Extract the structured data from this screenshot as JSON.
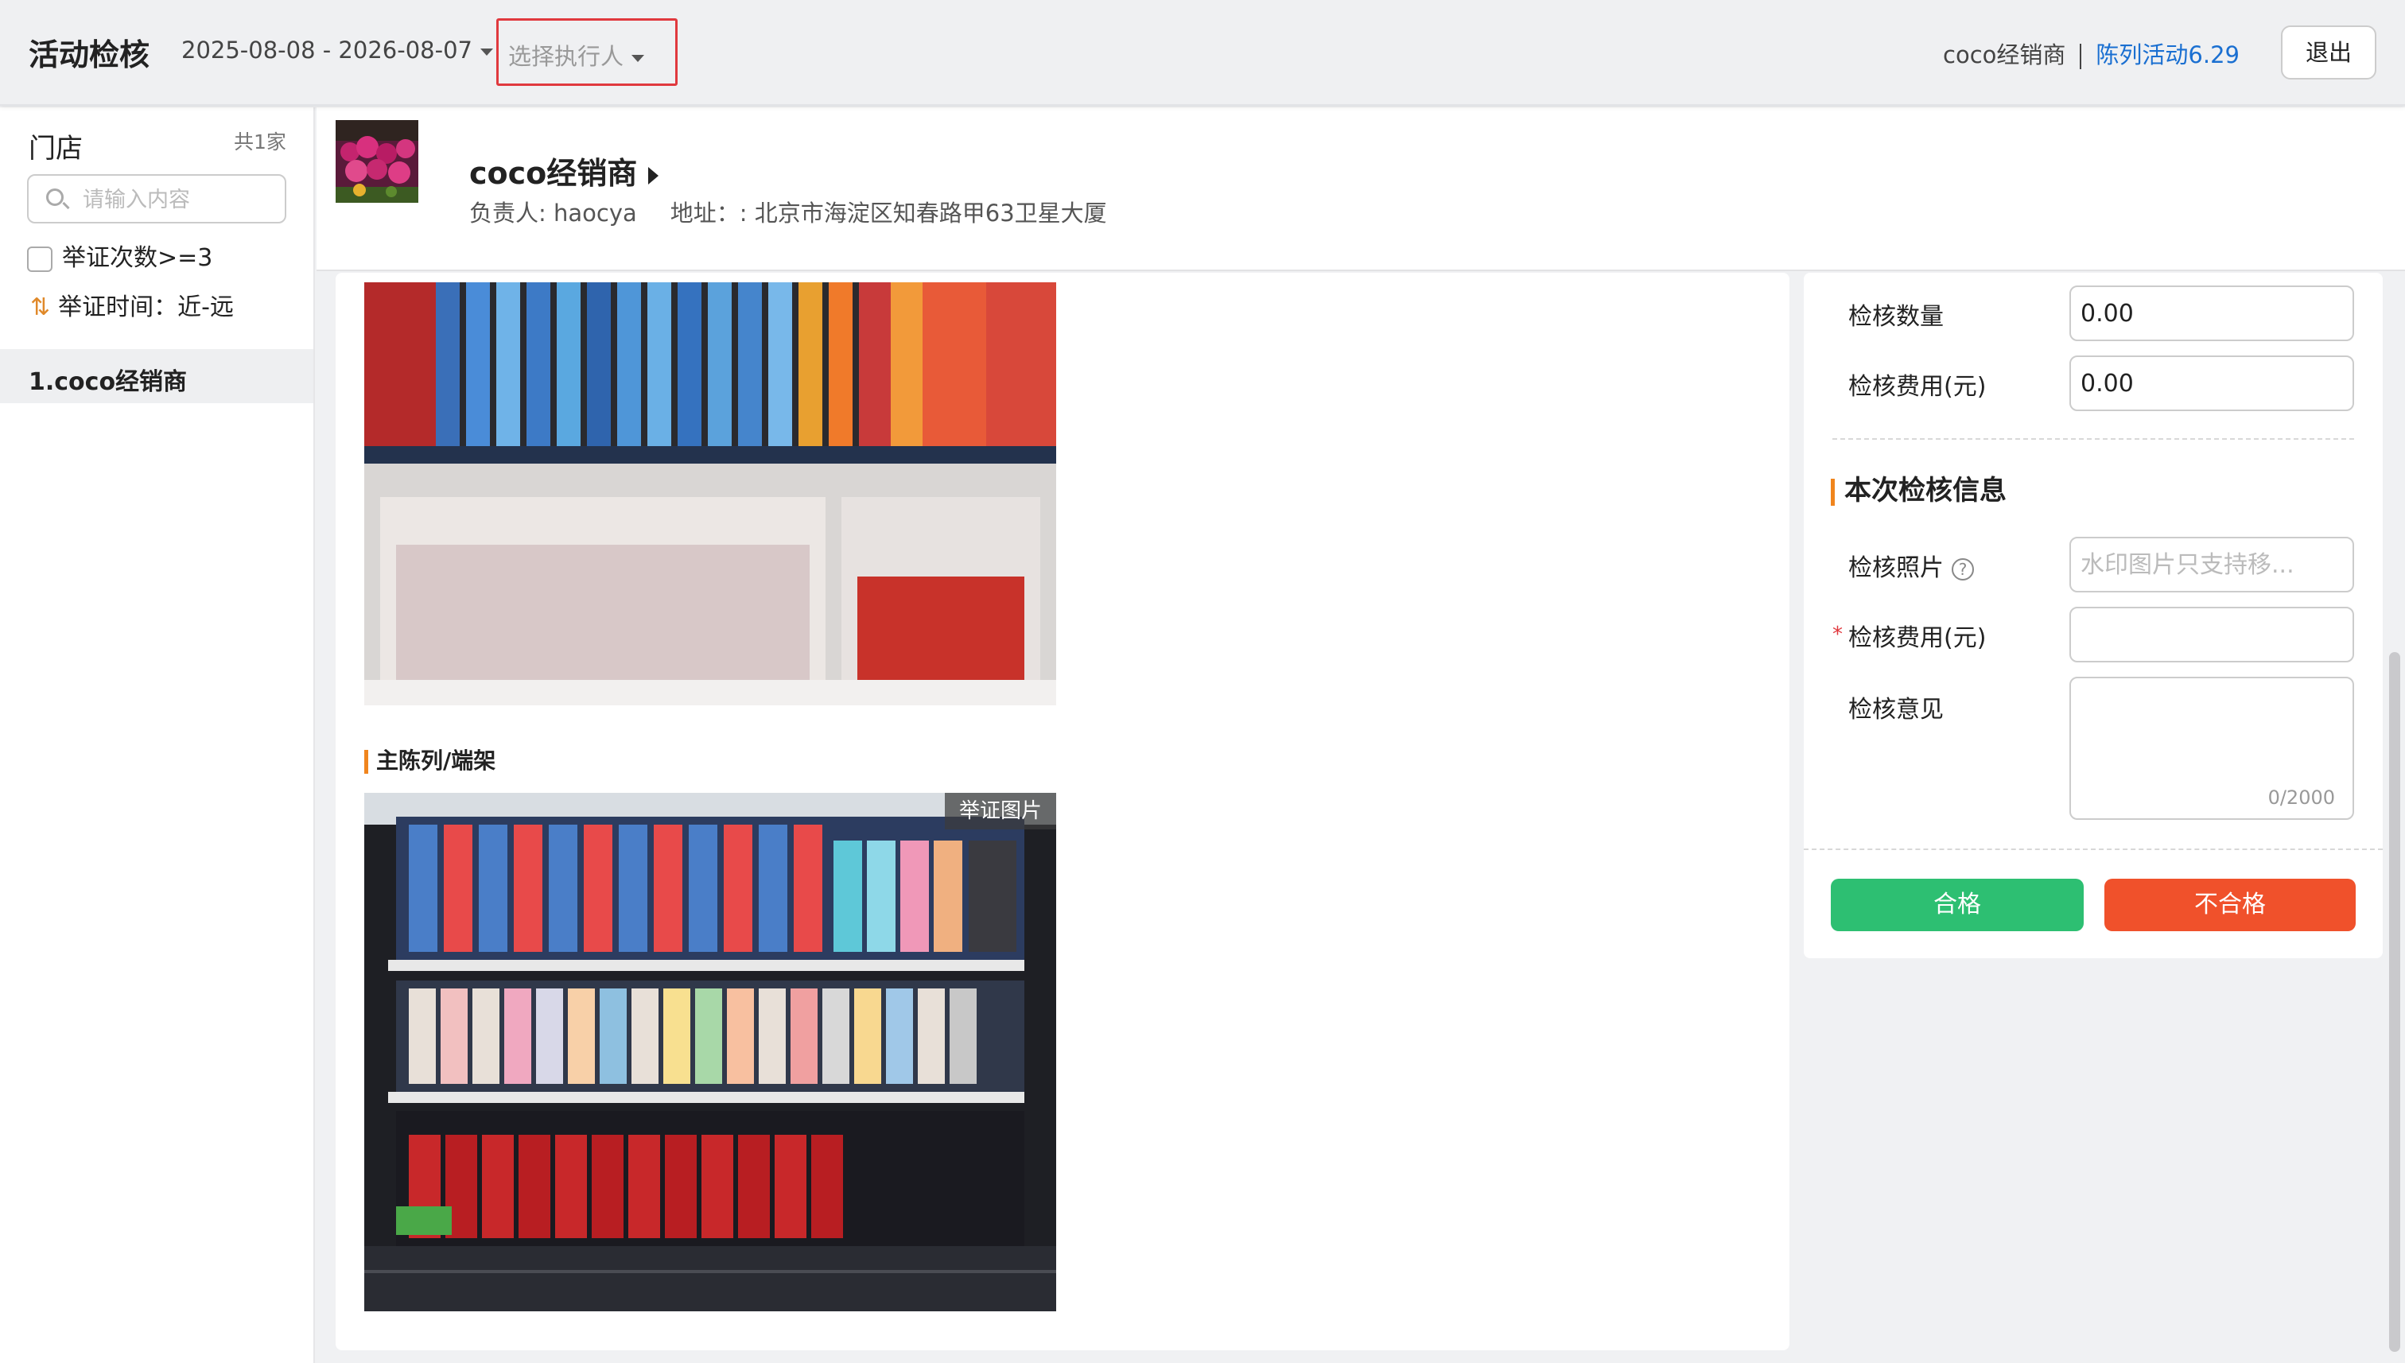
{
  "header": {
    "title": "活动检核",
    "date_range": "2025-08-08 - 2026-08-07",
    "executor_placeholder": "选择执行人",
    "dealer": "coco经销商",
    "activity": "陈列活动6.29",
    "logout_label": "退出"
  },
  "sidebar": {
    "title": "门店",
    "count": "共1家",
    "search_placeholder": "请输入内容",
    "filter_label": "举证次数>=3",
    "sort_label": "举证时间：近-远",
    "items": [
      {
        "label": "1.coco经销商"
      }
    ]
  },
  "store": {
    "name": "coco经销商",
    "owner": "负责人: haocya",
    "address": "地址：: 北京市海淀区知春路甲63卫星大厦"
  },
  "photos": {
    "section_label": "主陈列/端架",
    "tag_label": "举证图片"
  },
  "form": {
    "quantity_label": "检核数量",
    "quantity_value": "0.00",
    "cost_label": "检核费用(元)",
    "cost_value": "0.00",
    "section_title": "本次检核信息",
    "photo_label": "检核照片",
    "photo_placeholder": "水印图片只支持移...",
    "required_mark": "*",
    "fee_label": "检核费用(元)",
    "opinion_label": "检核意见",
    "char_count": "0/2000",
    "pass_label": "合格",
    "fail_label": "不合格"
  },
  "colors": {
    "accent_blue": "#1a6fd1",
    "accent_orange": "#f0851d",
    "pass_green": "#2dbf72",
    "fail_red": "#f0512b",
    "highlight_border": "#e0393e"
  }
}
